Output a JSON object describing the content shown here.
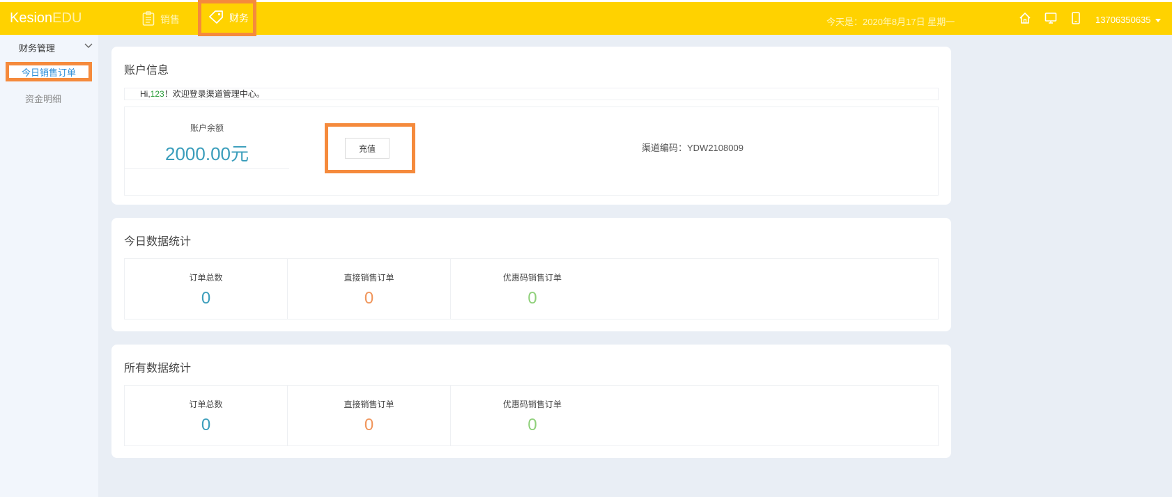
{
  "header": {
    "logo_main": "Kesion",
    "logo_suffix": "EDU",
    "nav": [
      {
        "label": "销售",
        "icon": "clipboard-icon"
      },
      {
        "label": "财务",
        "icon": "tag-icon"
      }
    ],
    "date_text": "今天是：2020年8月17日 星期一",
    "user": "13706350635",
    "icons": [
      "home-icon",
      "monitor-icon",
      "mobile-icon"
    ],
    "colors": {
      "bar": "#ffd200",
      "highlight": "#f58a3c"
    }
  },
  "sidebar": {
    "group_label": "财务管理",
    "items": [
      {
        "label": "今日销售订单",
        "active": true
      },
      {
        "label": "资金明细",
        "active": false
      }
    ]
  },
  "account": {
    "title": "账户信息",
    "welcome_prefix": "Hi,",
    "username": "123",
    "welcome_suffix": "！欢迎登录渠道管理中心。",
    "balance_label": "账户余额",
    "balance_value": "2000.00元",
    "recharge_label": "充值",
    "channel_code": "渠道编码：YDW2108009"
  },
  "today_stats": {
    "title": "今日数据统计",
    "items": [
      {
        "label": "订单总数",
        "value": "0"
      },
      {
        "label": "直接销售订单",
        "value": "0"
      },
      {
        "label": "优惠码销售订单",
        "value": "0"
      }
    ]
  },
  "all_stats": {
    "title": "所有数据统计",
    "items": [
      {
        "label": "订单总数",
        "value": "0"
      },
      {
        "label": "直接销售订单",
        "value": "0"
      },
      {
        "label": "优惠码销售订单",
        "value": "0"
      }
    ]
  }
}
